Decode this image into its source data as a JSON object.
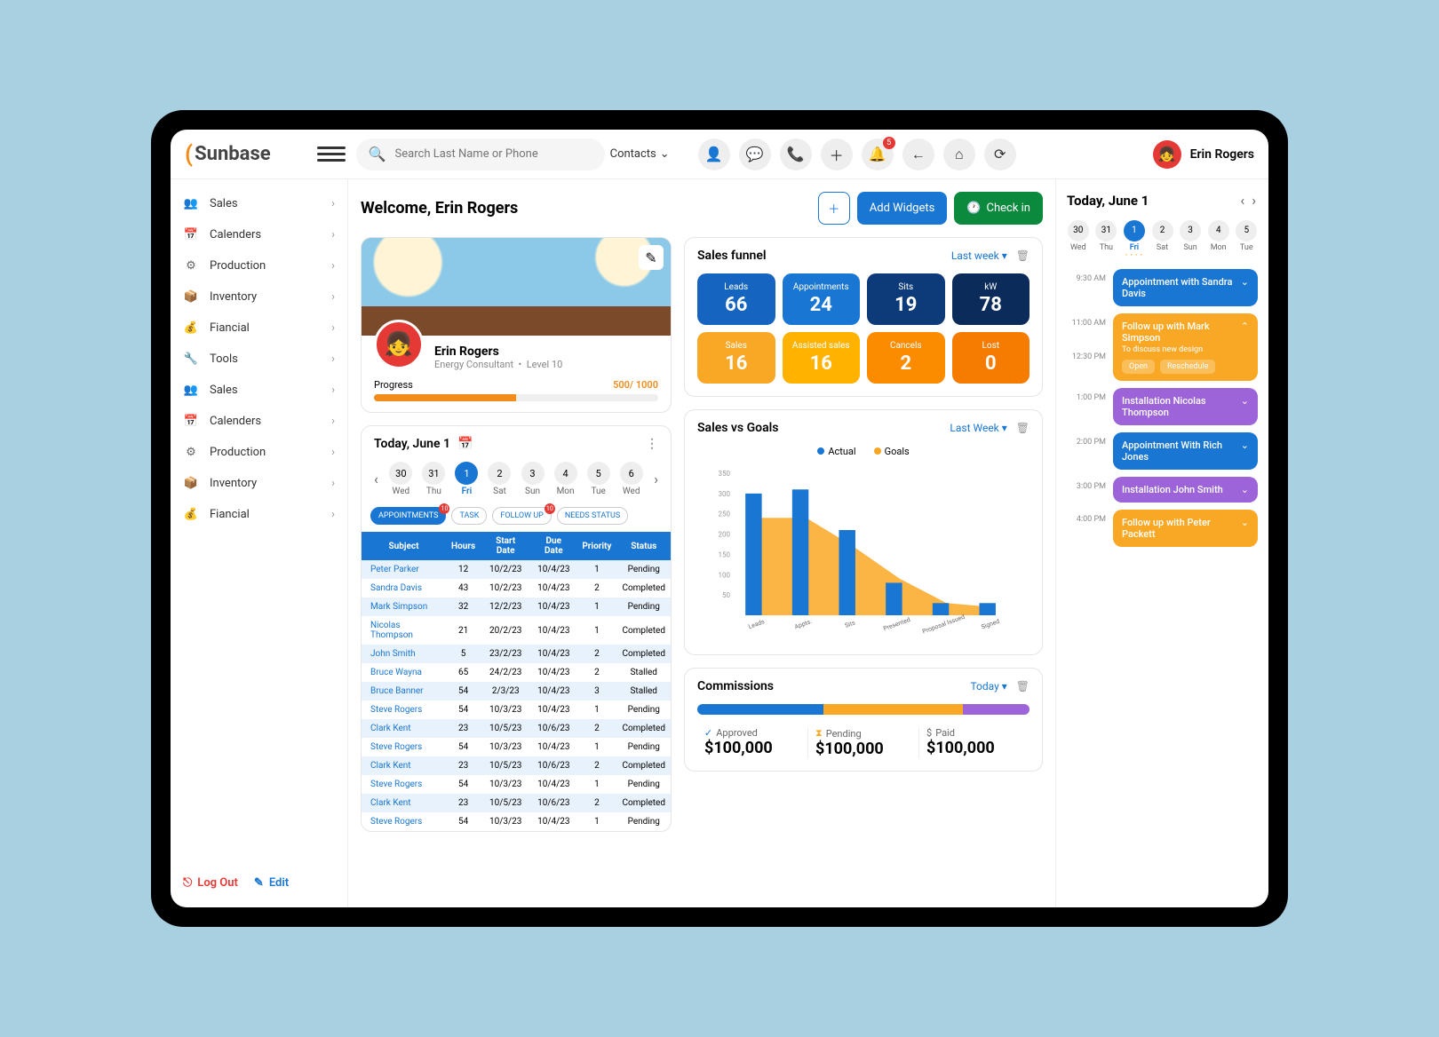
{
  "brand": "Sunbase",
  "search": {
    "placeholder": "Search Last Name or Phone",
    "filter": "Contacts"
  },
  "notif_count": "5",
  "user_name": "Erin Rogers",
  "sidebar": {
    "items": [
      {
        "icon": "👥",
        "label": "Sales"
      },
      {
        "icon": "📅",
        "label": "Calenders"
      },
      {
        "icon": "⚙",
        "label": "Production"
      },
      {
        "icon": "📦",
        "label": "Inventory"
      },
      {
        "icon": "💰",
        "label": "Fiancial"
      },
      {
        "icon": "🔧",
        "label": "Tools"
      },
      {
        "icon": "👥",
        "label": "Sales"
      },
      {
        "icon": "📅",
        "label": "Calenders"
      },
      {
        "icon": "⚙",
        "label": "Production"
      },
      {
        "icon": "📦",
        "label": "Inventory"
      },
      {
        "icon": "💰",
        "label": "Fiancial"
      }
    ],
    "logout": "Log Out",
    "edit": "Edit"
  },
  "welcome": "Welcome, Erin Rogers",
  "actions": {
    "add_widgets": "Add Widgets",
    "check_in": "Check in"
  },
  "profile": {
    "name": "Erin Rogers",
    "role": "Energy Consultant",
    "level": "Level 10",
    "progress_label": "Progress",
    "progress_value": "500/ 1000",
    "progress_pct": 50
  },
  "today": {
    "title": "Today, June 1",
    "days": [
      {
        "num": "30",
        "lbl": "Wed"
      },
      {
        "num": "31",
        "lbl": "Thu"
      },
      {
        "num": "1",
        "lbl": "Fri",
        "active": true
      },
      {
        "num": "2",
        "lbl": "Sat"
      },
      {
        "num": "3",
        "lbl": "Sun"
      },
      {
        "num": "4",
        "lbl": "Mon"
      },
      {
        "num": "5",
        "lbl": "Tue"
      },
      {
        "num": "6",
        "lbl": "Wed"
      }
    ],
    "pills": [
      {
        "label": "APPOINTMENTS",
        "active": true,
        "badge": "10"
      },
      {
        "label": "TASK"
      },
      {
        "label": "FOLLOW UP",
        "badge": "10"
      },
      {
        "label": "NEEDS STATUS"
      }
    ],
    "columns": [
      "Subject",
      "Hours",
      "Start Date",
      "Due Date",
      "Priority",
      "Status"
    ],
    "rows": [
      [
        "Peter Parker",
        "12",
        "10/2/23",
        "10/4/23",
        "1",
        "Pending"
      ],
      [
        "Sandra Davis",
        "43",
        "10/2/23",
        "10/4/23",
        "2",
        "Completed"
      ],
      [
        "Mark Simpson",
        "32",
        "12/2/23",
        "10/4/23",
        "1",
        "Pending"
      ],
      [
        "Nicolas Thompson",
        "21",
        "20/2/23",
        "10/4/23",
        "1",
        "Completed"
      ],
      [
        "John Smith",
        "5",
        "23/2/23",
        "10/4/23",
        "2",
        "Completed"
      ],
      [
        "Bruce Wayna",
        "65",
        "24/2/23",
        "10/4/23",
        "2",
        "Stalled"
      ],
      [
        "Bruce Banner",
        "54",
        "2/3/23",
        "10/4/23",
        "3",
        "Stalled"
      ],
      [
        "Steve Rogers",
        "54",
        "10/3/23",
        "10/4/23",
        "1",
        "Pending"
      ],
      [
        "Clark Kent",
        "23",
        "10/5/23",
        "10/6/23",
        "2",
        "Completed"
      ],
      [
        "Steve Rogers",
        "54",
        "10/3/23",
        "10/4/23",
        "1",
        "Pending"
      ],
      [
        "Clark Kent",
        "23",
        "10/5/23",
        "10/6/23",
        "2",
        "Completed"
      ],
      [
        "Steve Rogers",
        "54",
        "10/3/23",
        "10/4/23",
        "1",
        "Pending"
      ],
      [
        "Clark Kent",
        "23",
        "10/5/23",
        "10/6/23",
        "2",
        "Completed"
      ],
      [
        "Steve Rogers",
        "54",
        "10/3/23",
        "10/4/23",
        "1",
        "Pending"
      ]
    ]
  },
  "funnel": {
    "title": "Sales funnel",
    "range": "Last week",
    "tiles": [
      {
        "label": "Leads",
        "value": "66",
        "bg": "#1565c0"
      },
      {
        "label": "Appointments",
        "value": "24",
        "bg": "#1976d2"
      },
      {
        "label": "Sits",
        "value": "19",
        "bg": "#0d3b7a"
      },
      {
        "label": "kW",
        "value": "78",
        "bg": "#0b2b5a"
      },
      {
        "label": "Sales",
        "value": "16",
        "bg": "#f9a825",
        "fg": "#fff"
      },
      {
        "label": "Assisted sales",
        "value": "16",
        "bg": "#ffb300"
      },
      {
        "label": "Cancels",
        "value": "2",
        "bg": "#fb8c00"
      },
      {
        "label": "Lost",
        "value": "0",
        "bg": "#f57c00"
      }
    ]
  },
  "chart_data": {
    "type": "bar",
    "title": "Sales vs Goals",
    "range": "Last Week",
    "legend": {
      "actual": "Actual",
      "goals": "Goals",
      "actual_color": "#1976d2",
      "goals_color": "#f9a825"
    },
    "categories": [
      "Leads",
      "Appts.",
      "Sits",
      "Presented",
      "Proposal Issued",
      "Signed"
    ],
    "series": [
      {
        "name": "Actual",
        "values": [
          300,
          310,
          210,
          80,
          30,
          30
        ],
        "color": "#1976d2"
      },
      {
        "name": "Goals",
        "values": [
          240,
          240,
          170,
          90,
          30,
          20
        ],
        "color": "#f9a825"
      }
    ],
    "ylim": [
      0,
      350
    ],
    "yticks": [
      50,
      100,
      150,
      200,
      250,
      300,
      350
    ]
  },
  "commissions": {
    "title": "Commissions",
    "range": "Today",
    "segments": [
      {
        "color": "#1976d2",
        "pct": 38
      },
      {
        "color": "#f9a825",
        "pct": 42
      },
      {
        "color": "#9c64d8",
        "pct": 20
      }
    ],
    "stats": [
      {
        "icon": "✓",
        "label": "Approved",
        "value": "$100,000",
        "color": "#1976d2"
      },
      {
        "icon": "⧗",
        "label": "Pending",
        "value": "$100,000",
        "color": "#f9a825"
      },
      {
        "icon": "$",
        "label": "Paid",
        "value": "$100,000",
        "color": "#666"
      }
    ]
  },
  "side": {
    "title": "Today, June 1",
    "days": [
      {
        "num": "30",
        "lbl": "Wed"
      },
      {
        "num": "31",
        "lbl": "Thu"
      },
      {
        "num": "1",
        "lbl": "Fri",
        "active": true,
        "dots": "• • • •"
      },
      {
        "num": "2",
        "lbl": "Sat"
      },
      {
        "num": "3",
        "lbl": "Sun"
      },
      {
        "num": "4",
        "lbl": "Mon"
      },
      {
        "num": "5",
        "lbl": "Tue"
      }
    ],
    "events": [
      {
        "time": "9:30 AM",
        "title": "Appointment with Sandra Davis",
        "color": "#1976d2"
      },
      {
        "time": "11:00 AM",
        "title": "Follow up with Mark Simpson",
        "color": "#f9a825",
        "desc": "To discuss new design",
        "expanded": true,
        "extra_time": "12:30 PM",
        "actions": [
          "Open",
          "Reschedule"
        ]
      },
      {
        "time": "1:00 PM",
        "title": "Installation Nicolas Thompson",
        "color": "#9c64d8"
      },
      {
        "time": "2:00 PM",
        "title": "Appointment With Rich Jones",
        "color": "#1976d2"
      },
      {
        "time": "3:00 PM",
        "title": "Installation John Smith",
        "color": "#9c64d8"
      },
      {
        "time": "4:00 PM",
        "title": "Follow up with Peter Packett",
        "color": "#f9a825"
      }
    ]
  }
}
